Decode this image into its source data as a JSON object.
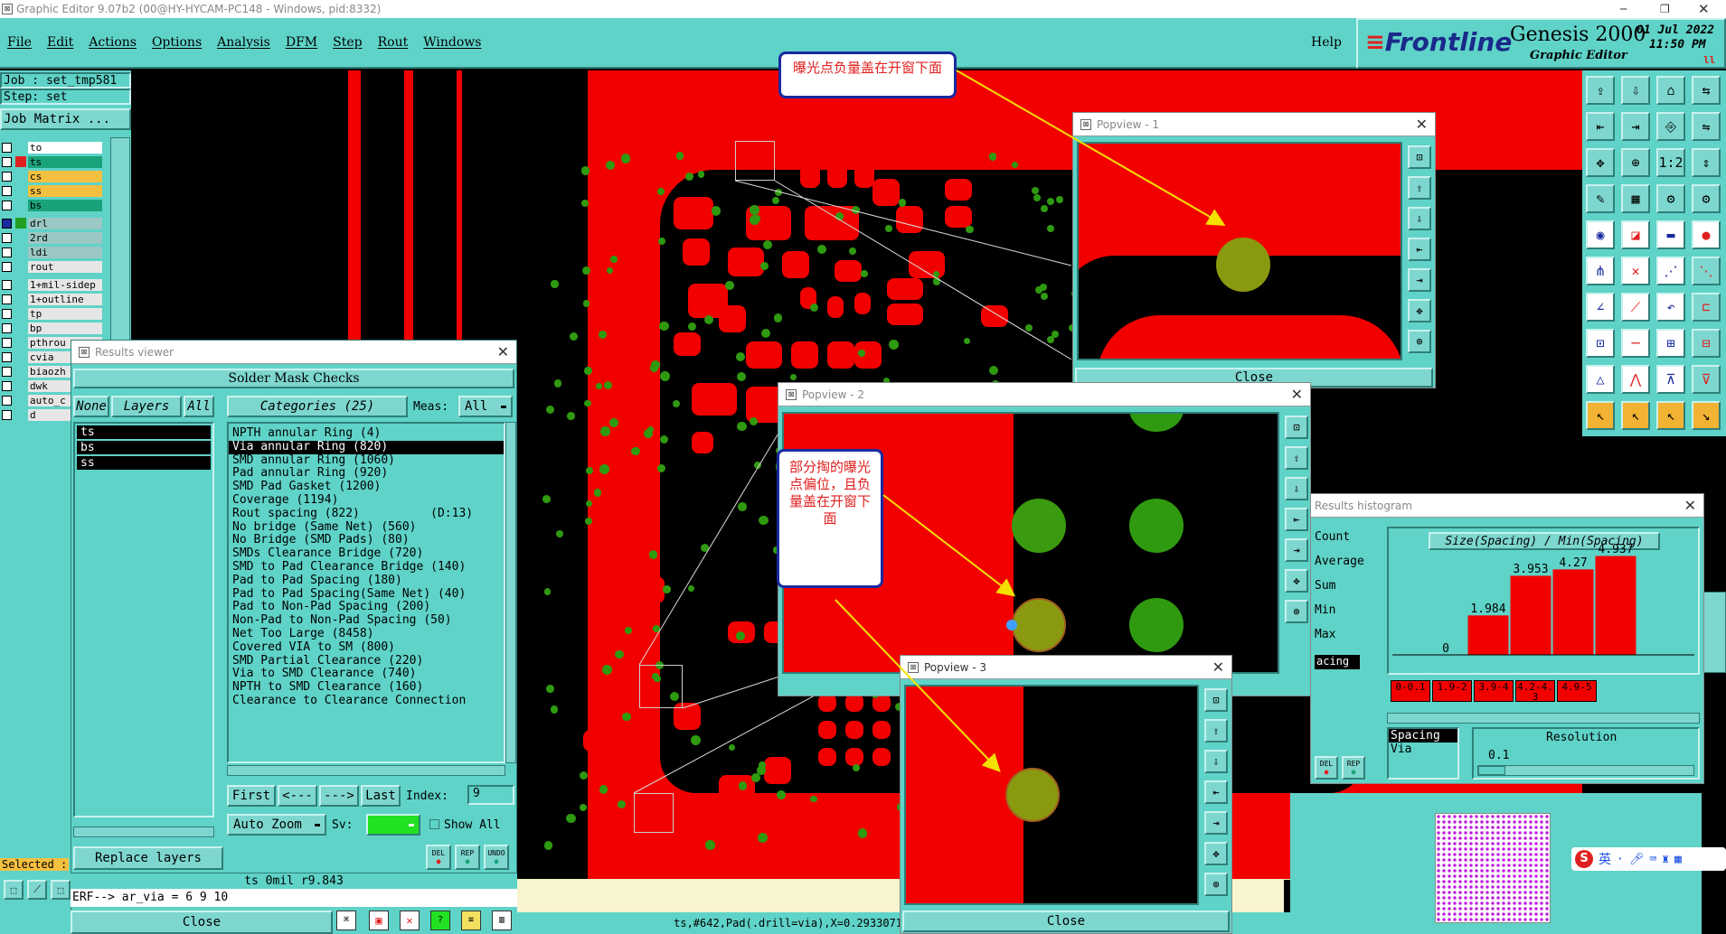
{
  "window_title": "Graphic Editor 9.07b2 (00@HY-HYCAM-PC148 - Windows, pid:8332)",
  "menu": [
    "File",
    "Edit",
    "Actions",
    "Options",
    "Analysis",
    "DFM",
    "Step",
    "Rout",
    "Windows"
  ],
  "help": "Help",
  "brand": {
    "logo": "Frontline",
    "product": "Genesis 2000",
    "sub": "Graphic Editor",
    "date": "01 Jul 2022",
    "time": "11:50 PM"
  },
  "job": {
    "job_label": "Job : set_tmp581",
    "step_label": "Step: set",
    "matrix_btn": "Job Matrix ..."
  },
  "layers": [
    {
      "name": "to",
      "color": "#ffffff"
    },
    {
      "name": "ts",
      "color": "#1aa37a"
    },
    {
      "name": "cs",
      "color": "#f4c040"
    },
    {
      "name": "ss",
      "color": "#f4c040"
    },
    {
      "name": "bs",
      "color": "#1aa37a"
    },
    {
      "name": "drl",
      "color": "#9bc8c4"
    },
    {
      "name": "2rd",
      "color": "#9bc8c4"
    },
    {
      "name": "ldi",
      "color": "#9bc8c4"
    },
    {
      "name": "rout",
      "color": "#e6e6e6"
    },
    {
      "name": "1+mil-sidep",
      "color": "#e6e6e6"
    },
    {
      "name": "1+outline",
      "color": "#e6e6e6"
    },
    {
      "name": "tp",
      "color": "#e6e6e6"
    },
    {
      "name": "bp",
      "color": "#e6e6e6"
    },
    {
      "name": "pthrou",
      "color": "#e6e6e6"
    },
    {
      "name": "cvia",
      "color": "#e6e6e6"
    },
    {
      "name": "biaozh",
      "color": "#e6e6e6"
    },
    {
      "name": "dwk",
      "color": "#e6e6e6"
    },
    {
      "name": "auto_c",
      "color": "#e6e6e6"
    },
    {
      "name": "d",
      "color": "#e6e6e6"
    }
  ],
  "selected_label": "Selected :",
  "results": {
    "title": "Results viewer",
    "header": "Solder Mask Checks",
    "none": "None",
    "layers_btn": "Layers",
    "all": "All",
    "categories": "Categories (25)",
    "meas_label": "Meas:",
    "meas_value": "All",
    "layer_list": [
      "ts",
      "bs",
      "ss"
    ],
    "items": [
      "NPTH annular Ring (4)",
      "Via annular Ring (820)",
      "SMD annular Ring (1060)",
      "Pad annular Ring (920)",
      "SMD Pad Gasket (1200)",
      "Coverage (1194)",
      "Rout spacing (822)          (D:13)",
      "No bridge (Same Net) (560)",
      "No Bridge (SMD Pads) (80)",
      "SMDs Clearance Bridge (720)",
      "SMD to Pad Clearance Bridge (140)",
      "Pad to Pad Spacing (180)",
      "Pad to Pad Spacing(Same Net) (40)",
      "Pad to Non-Pad Spacing (200)",
      "Non-Pad to Non-Pad Spacing (50)",
      "Net Too Large (8458)",
      "Covered VIA to SM (800)",
      "SMD Partial Clearance (220)",
      "Via to SMD Clearance (740)",
      "NPTH to SMD Clearance (160)",
      "Clearance to Clearance Connection"
    ],
    "first": "First",
    "prev": "<---",
    "next": "--->",
    "last": "Last",
    "index_label": "Index:",
    "index_value": "9",
    "auto_zoom": "Auto Zoom",
    "sv": "Sv:",
    "show_all": "Show All",
    "replace": "Replace layers",
    "close": "Close",
    "del": "DEL",
    "rep": "REP",
    "undo": "UNDO"
  },
  "status": {
    "units": "ts 0mil  r9.843",
    "erf": "ERF--> ar_via = 6 9 10",
    "coords": "ts,#642,Pad(.drill=via),X=0.2933071"
  },
  "popview1": {
    "title": "Popview - 1",
    "close": "Close"
  },
  "popview2": {
    "title": "Popview - 2"
  },
  "popview3": {
    "title": "Popview - 3",
    "close": "Close"
  },
  "histogram": {
    "title": "Results histogram",
    "labels": [
      "Count",
      "Average",
      "Sum",
      "Min",
      "Max"
    ],
    "spacing": "acing",
    "chart_title": "Size(Spacing) / Min(Spacing)",
    "chart_data": {
      "type": "bar",
      "categories": [
        "0-0.1",
        "1.9-2",
        "3.9-4",
        "4.2-4.3",
        "4.9-5"
      ],
      "values": [
        0,
        1.984,
        3.953,
        4.27,
        4.937
      ],
      "ylim": [
        0,
        4.937
      ]
    },
    "list": [
      "Spacing",
      "Via"
    ],
    "resolution_label": "Resolution",
    "resolution_value": "0.1"
  },
  "callouts": {
    "a": "曝光点负量盖在开窗下面",
    "b": "部分掏的曝光点偏位，且负量盖在开窗下面"
  },
  "ime": {
    "s": "S",
    "lang": "英"
  }
}
